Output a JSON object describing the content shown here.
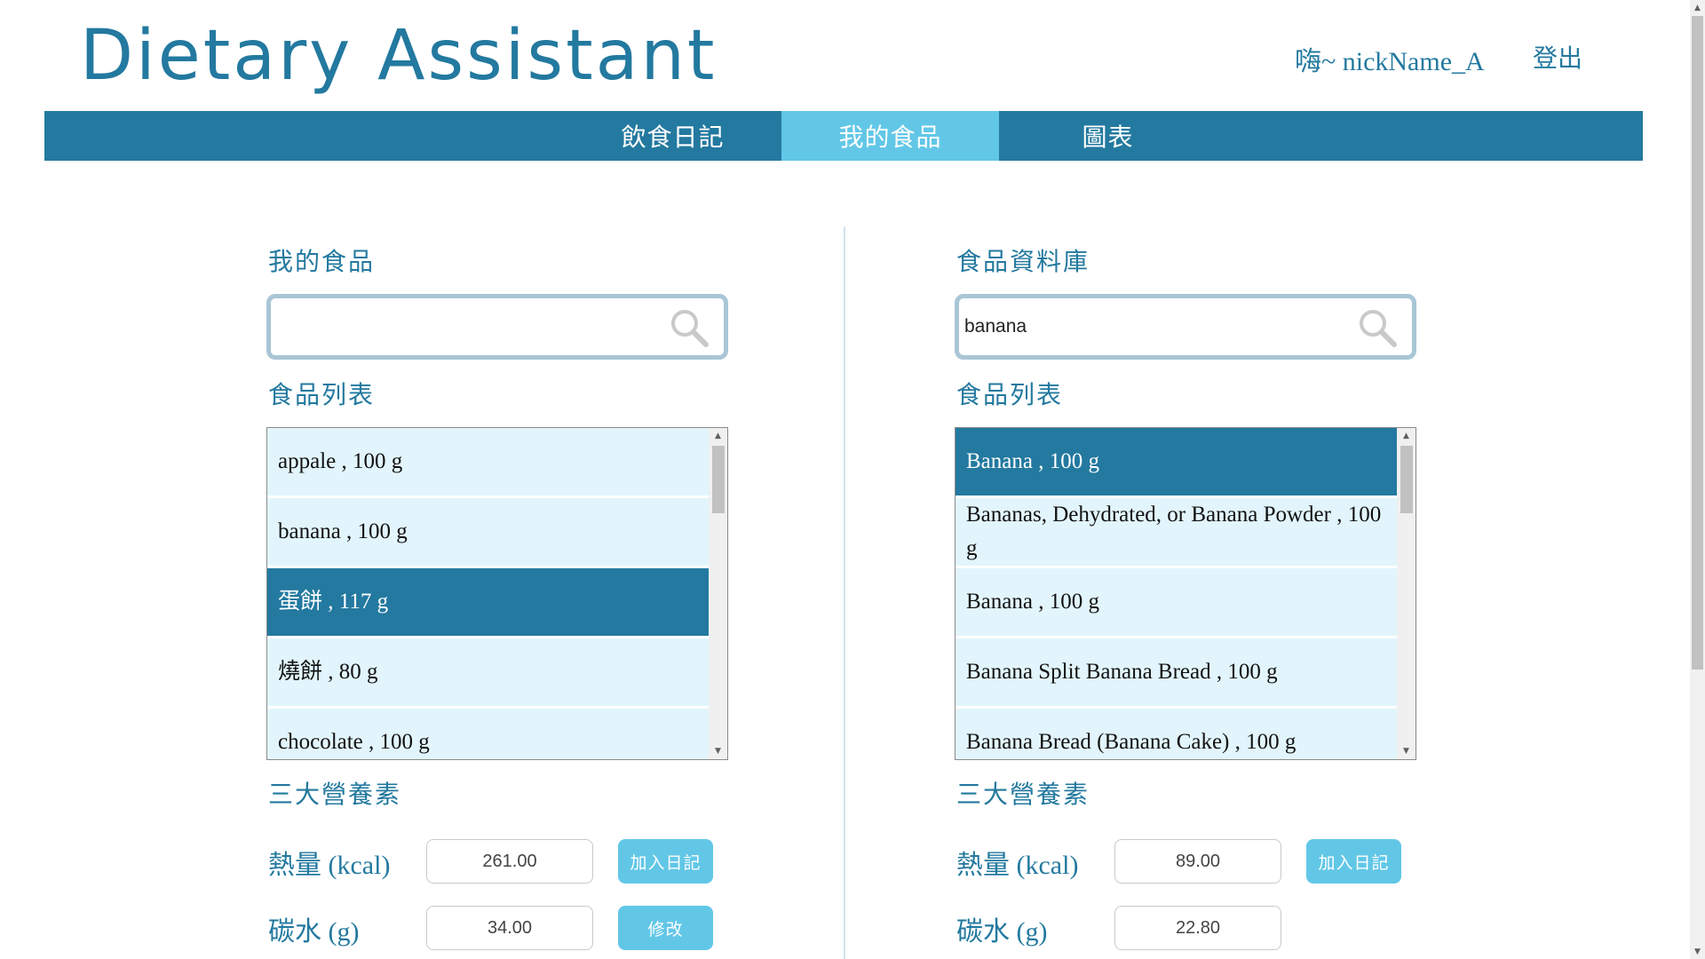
{
  "header": {
    "title": "Dietary Assistant",
    "greeting": "嗨~ nickName_A",
    "logout": "登出"
  },
  "nav": {
    "tabs": [
      {
        "label": "飲食日記",
        "active": false
      },
      {
        "label": "我的食品",
        "active": true
      },
      {
        "label": "圖表",
        "active": false
      }
    ]
  },
  "left_panel": {
    "title": "我的食品",
    "search": {
      "value": "",
      "placeholder": ""
    },
    "list_title": "食品列表",
    "items": [
      {
        "label": "appale , 100 g",
        "selected": false
      },
      {
        "label": "banana , 100 g",
        "selected": false
      },
      {
        "label": "蛋餅 , 117 g",
        "selected": true
      },
      {
        "label": "燒餅 , 80 g",
        "selected": false
      },
      {
        "label": "chocolate , 100 g",
        "selected": false
      }
    ],
    "nutrients_title": "三大營養素",
    "nutrients": [
      {
        "label": "熱量 (kcal)",
        "value": "261.00",
        "button": "加入日記"
      },
      {
        "label": "碳水 (g)",
        "value": "34.00",
        "button": "修改"
      }
    ]
  },
  "right_panel": {
    "title": "食品資料庫",
    "search": {
      "value": "banana",
      "placeholder": ""
    },
    "list_title": "食品列表",
    "items": [
      {
        "label": "Banana , 100 g",
        "selected": true
      },
      {
        "label": "Bananas, Dehydrated, or Banana Powder , 100 g",
        "selected": false
      },
      {
        "label": "Banana , 100 g",
        "selected": false
      },
      {
        "label": "Banana Split Banana Bread , 100 g",
        "selected": false
      },
      {
        "label": "Banana Bread (Banana Cake) , 100 g",
        "selected": false
      }
    ],
    "nutrients_title": "三大營養素",
    "nutrients": [
      {
        "label": "熱量 (kcal)",
        "value": "89.00",
        "button": "加入日記"
      },
      {
        "label": "碳水 (g)",
        "value": "22.80",
        "button": ""
      }
    ]
  },
  "colors": {
    "primary": "#23799f",
    "accent": "#62c7e7",
    "list_bg": "#e2f5fc"
  }
}
